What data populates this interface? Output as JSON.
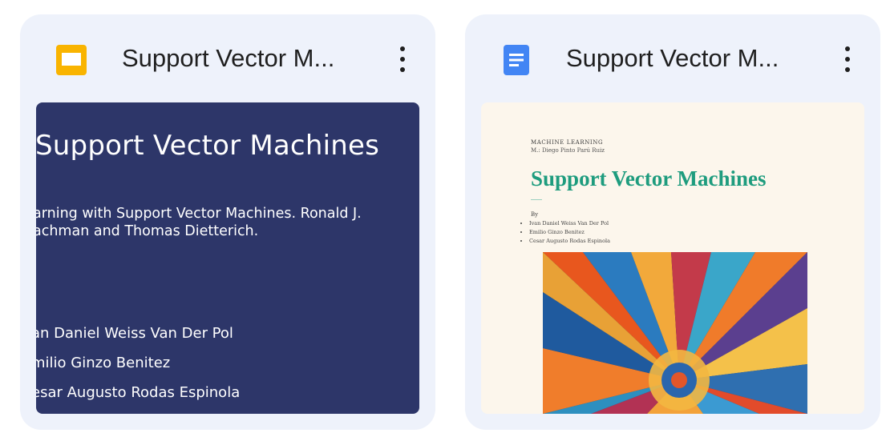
{
  "cards": [
    {
      "type": "slides",
      "title": "Support Vector M...",
      "icon": "google-slides-icon",
      "icon_color": "#f9b400",
      "menu_icon": "more-vert-icon",
      "thumbnail": {
        "background": "#2d3669",
        "title": "Support Vector Machines",
        "reference_lines": [
          "arning with Support Vector Machines. Ronald J.",
          "achman and Thomas Dietterich."
        ],
        "authors": [
          "an Daniel Weiss Van Der Pol",
          "milio Ginzo Benitez",
          "esar Augusto Rodas Espinola"
        ]
      }
    },
    {
      "type": "docs",
      "title": "Support Vector M...",
      "icon": "google-docs-icon",
      "icon_color": "#4285f4",
      "menu_icon": "more-vert-icon",
      "thumbnail": {
        "background": "#fcf6ec",
        "kicker": "MACHINE LEARNING",
        "subtitle": "M.: Diego Pinto Parú Ruiz",
        "title": "Support Vector Machines",
        "by_label": "By",
        "authors": [
          "Ivan Daniel Weiss Van Der Pol",
          "Emilio Ginzo Benitez",
          "Cesar Augusto Rodas Espinola"
        ],
        "title_color": "#1e9c7e"
      }
    }
  ]
}
